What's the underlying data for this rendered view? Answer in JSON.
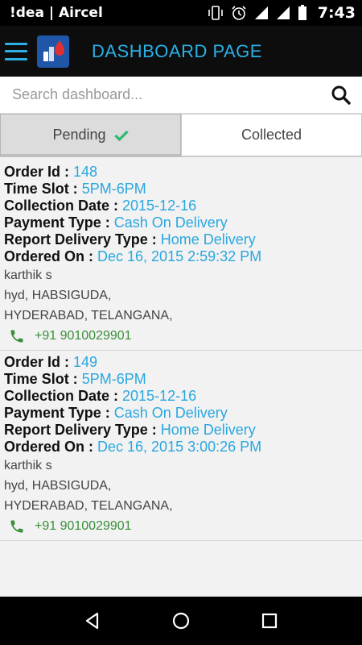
{
  "status_bar": {
    "carrier": "!dea | Aircel",
    "time": "7:43",
    "icons": [
      "vibrate-icon",
      "alarm-icon",
      "signal-icon",
      "signal-icon",
      "battery-icon"
    ]
  },
  "app_bar": {
    "title": "DASHBOARD PAGE",
    "accent_color": "#2bb0e6"
  },
  "search": {
    "placeholder": "Search dashboard..."
  },
  "tabs": [
    {
      "label": "Pending",
      "active": true
    },
    {
      "label": "Collected",
      "active": false
    }
  ],
  "labels": {
    "order_id": "Order Id : ",
    "time_slot": "Time Slot : ",
    "collection_date": "Collection Date : ",
    "payment_type": "Payment Type : ",
    "report_delivery_type": "Report Delivery Type : ",
    "ordered_on": "Ordered On : "
  },
  "orders": [
    {
      "order_id": "148",
      "time_slot": "5PM-6PM",
      "collection_date": "2015-12-16",
      "payment_type": "Cash On Delivery",
      "report_delivery_type": "Home Delivery",
      "ordered_on": "Dec 16, 2015 2:59:32 PM",
      "name": "karthik s",
      "address_line1": "hyd, HABSIGUDA,",
      "address_line2": "HYDERABAD, TELANGANA,",
      "phone": "+91 9010029901"
    },
    {
      "order_id": "149",
      "time_slot": "5PM-6PM",
      "collection_date": "2015-12-16",
      "payment_type": "Cash On Delivery",
      "report_delivery_type": "Home Delivery",
      "ordered_on": "Dec 16, 2015 3:00:26 PM",
      "name": "karthik s",
      "address_line1": "hyd, HABSIGUDA,",
      "address_line2": "HYDERABAD, TELANGANA,",
      "phone": "+91 9010029901"
    }
  ],
  "nav_bar": {
    "buttons": [
      "back-icon",
      "home-icon",
      "recents-icon"
    ]
  }
}
